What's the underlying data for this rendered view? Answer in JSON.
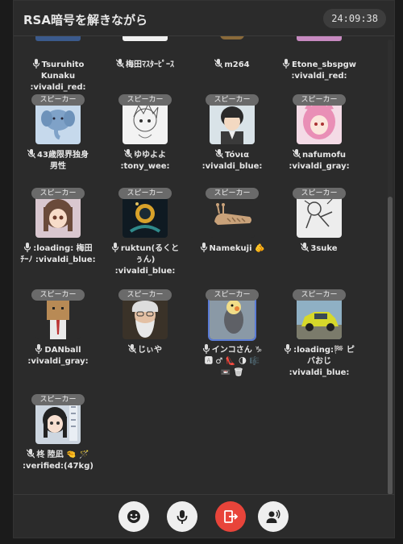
{
  "header": {
    "title": "RSA暗号を解きながら",
    "clock": "24:09:38"
  },
  "speaker_label": "スピーカー",
  "top_row": [
    {
      "name": "Tsuruhito\nKunaku\n:vivaldi_red:",
      "muted": false
    },
    {
      "name": "梅田ﾏｽﾀｰﾋﾟｰｽ",
      "muted": true
    },
    {
      "name": "m264",
      "muted": true
    },
    {
      "name": "Etone_sbspgw\n:vivaldi_red:",
      "muted": false
    }
  ],
  "users": [
    {
      "name": "43歳限界独身\n男性",
      "muted": true,
      "avatar": "elephant"
    },
    {
      "name": "ゆゆよよ\n:tony_wee:",
      "muted": true,
      "avatar": "sketch"
    },
    {
      "name": "Tóνια\n:vivaldi_blue:",
      "muted": true,
      "avatar": "boy"
    },
    {
      "name": "nafumofu\n:vivaldi_gray:",
      "muted": true,
      "avatar": "pinkgirl"
    },
    {
      "name": ":loading: 梅田\nﾁｰﾉ :vivaldi_blue:",
      "muted": false,
      "avatar": "animegirl"
    },
    {
      "name": "ruktun(るくと\nぅん)\n:vivaldi_blue:",
      "muted": false,
      "avatar": "dark"
    },
    {
      "name": "Namekuji 🫵",
      "muted": false,
      "avatar": "slug"
    },
    {
      "name": "3suke",
      "muted": true,
      "avatar": "doodle"
    },
    {
      "name": "DANball\n:vivaldi_gray:",
      "muted": false,
      "avatar": "box"
    },
    {
      "name": "じぃや",
      "muted": true,
      "avatar": "oldman"
    },
    {
      "name": "インコさん ♑\n🅰 ♂ 👠 🌗 🎼\n📼 🗑",
      "muted": false,
      "avatar": "bird"
    },
    {
      "name": ":loading:🏁 ピ\nバおじ\n:vivaldi_blue:",
      "muted": false,
      "avatar": "car"
    },
    {
      "name": "柊 陸凪 🤏 🪄\n:verified:(47kg)",
      "muted": true,
      "avatar": "girl2"
    }
  ],
  "footer": {
    "buttons": [
      "emoji-reaction",
      "microphone",
      "leave",
      "request-speak"
    ]
  },
  "colors": {
    "accent_red": "#e8443a",
    "selected_outline": "#5a7bd6"
  }
}
